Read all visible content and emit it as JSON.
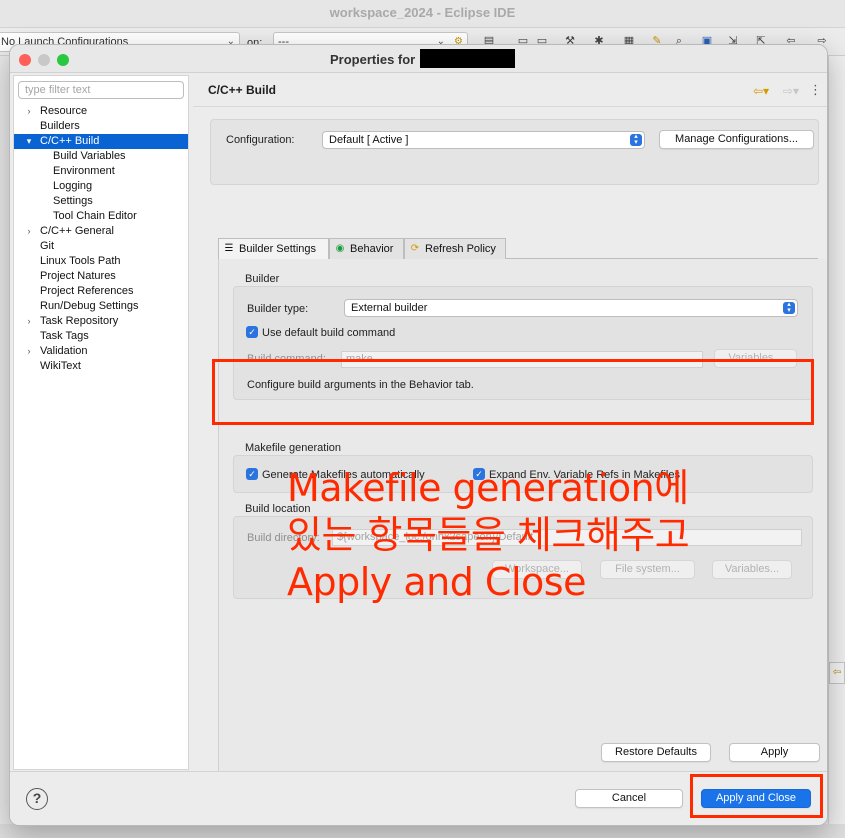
{
  "ide": {
    "window_title": "workspace_2024 - Eclipse IDE",
    "launch_config": "No Launch Configurations",
    "on_label": "on:",
    "target": "---"
  },
  "dialog": {
    "title_prefix": "Properties for"
  },
  "nav": {
    "filter_placeholder": "type filter text",
    "items": [
      {
        "label": "Resource",
        "expandable": true
      },
      {
        "label": "Builders"
      },
      {
        "label": "C/C++ Build",
        "expanded": true,
        "selected": true
      },
      {
        "label": "Build Variables",
        "child": true
      },
      {
        "label": "Environment",
        "child": true
      },
      {
        "label": "Logging",
        "child": true
      },
      {
        "label": "Settings",
        "child": true
      },
      {
        "label": "Tool Chain Editor",
        "child": true
      },
      {
        "label": "C/C++ General",
        "expandable": true
      },
      {
        "label": "Git"
      },
      {
        "label": "Linux Tools Path"
      },
      {
        "label": "Project Natures"
      },
      {
        "label": "Project References"
      },
      {
        "label": "Run/Debug Settings"
      },
      {
        "label": "Task Repository",
        "expandable": true
      },
      {
        "label": "Task Tags"
      },
      {
        "label": "Validation",
        "expandable": true
      },
      {
        "label": "WikiText"
      }
    ]
  },
  "page": {
    "title": "C/C++ Build",
    "configuration_label": "Configuration:",
    "configuration_value": "Default  [ Active ]",
    "manage_configurations": "Manage Configurations..."
  },
  "tabs": [
    {
      "label": "Builder Settings",
      "active": true,
      "icon": "builder-settings-icon"
    },
    {
      "label": "Behavior",
      "icon": "behavior-icon"
    },
    {
      "label": "Refresh Policy",
      "icon": "refresh-policy-icon"
    }
  ],
  "builder": {
    "group_title": "Builder",
    "type_label": "Builder type:",
    "type_value": "External builder",
    "use_default_label": "Use default build command",
    "use_default_checked": true,
    "command_label": "Build command:",
    "command_value": "make",
    "variables_button": "Variables...",
    "hint": "Configure build arguments in the Behavior tab."
  },
  "makefile": {
    "group_title": "Makefile generation",
    "generate_label": "Generate Makefiles automatically",
    "generate_checked": true,
    "expand_label": "Expand Env. Variable Refs in Makefiles",
    "expand_checked": true
  },
  "location": {
    "group_title": "Build location",
    "directory_label": "Build directory:",
    "directory_value": "${workspace_loc:/onnx2sapeon}/Default",
    "workspace_button": "Workspace...",
    "filesystem_button": "File system...",
    "variables_button": "Variables..."
  },
  "actions": {
    "restore_defaults": "Restore Defaults",
    "apply": "Apply",
    "cancel": "Cancel",
    "apply_and_close": "Apply and Close",
    "help": "?"
  },
  "annotation": {
    "lines": [
      "Makefile generation에",
      "있는 항목들을 체크해주고",
      "Apply and Close"
    ],
    "color": "#ff2a00"
  }
}
